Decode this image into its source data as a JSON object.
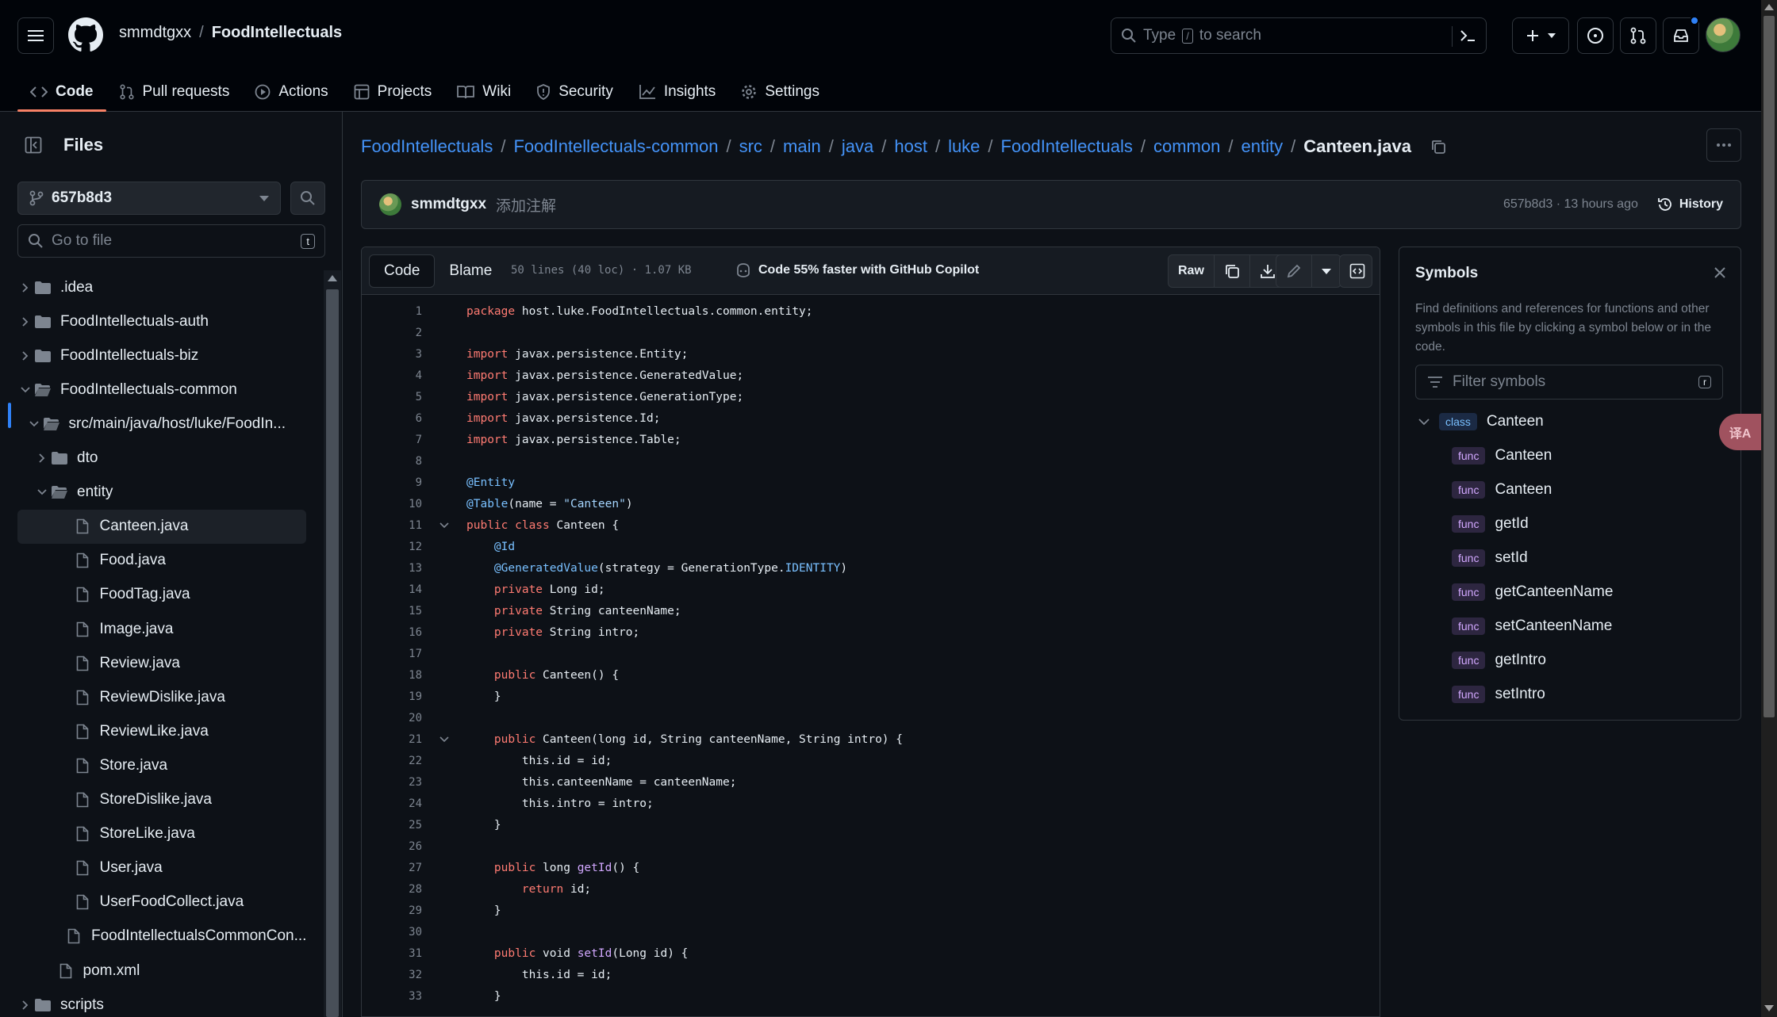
{
  "header": {
    "owner": "smmdtgxx",
    "separator": "/",
    "repo": "FoodIntellectuals",
    "search_prefix": "Type",
    "search_key": "/",
    "search_suffix": "to search"
  },
  "repo_nav": [
    {
      "label": "Code",
      "icon": "code-icon",
      "active": true
    },
    {
      "label": "Pull requests",
      "icon": "pull-request-icon"
    },
    {
      "label": "Actions",
      "icon": "play-icon"
    },
    {
      "label": "Projects",
      "icon": "table-icon"
    },
    {
      "label": "Wiki",
      "icon": "book-icon"
    },
    {
      "label": "Security",
      "icon": "shield-icon"
    },
    {
      "label": "Insights",
      "icon": "graph-icon"
    },
    {
      "label": "Settings",
      "icon": "gear-icon"
    }
  ],
  "sidebar": {
    "title": "Files",
    "branch": "657b8d3",
    "goto_placeholder": "Go to file",
    "goto_key": "t",
    "tree": [
      {
        "label": ".idea",
        "type": "folder",
        "depth": 0,
        "expanded": false
      },
      {
        "label": "FoodIntellectuals-auth",
        "type": "folder",
        "depth": 0,
        "expanded": false
      },
      {
        "label": "FoodIntellectuals-biz",
        "type": "folder",
        "depth": 0,
        "expanded": false
      },
      {
        "label": "FoodIntellectuals-common",
        "type": "folder",
        "depth": 0,
        "expanded": true
      },
      {
        "label": "src/main/java/host/luke/FoodIn...",
        "type": "folder",
        "depth": 1,
        "expanded": true
      },
      {
        "label": "dto",
        "type": "folder",
        "depth": 2,
        "expanded": false
      },
      {
        "label": "entity",
        "type": "folder",
        "depth": 2,
        "expanded": true
      },
      {
        "label": "Canteen.java",
        "type": "file",
        "depth": 3,
        "selected": true
      },
      {
        "label": "Food.java",
        "type": "file",
        "depth": 3
      },
      {
        "label": "FoodTag.java",
        "type": "file",
        "depth": 3
      },
      {
        "label": "Image.java",
        "type": "file",
        "depth": 3
      },
      {
        "label": "Review.java",
        "type": "file",
        "depth": 3
      },
      {
        "label": "ReviewDislike.java",
        "type": "file",
        "depth": 3
      },
      {
        "label": "ReviewLike.java",
        "type": "file",
        "depth": 3
      },
      {
        "label": "Store.java",
        "type": "file",
        "depth": 3
      },
      {
        "label": "StoreDislike.java",
        "type": "file",
        "depth": 3
      },
      {
        "label": "StoreLike.java",
        "type": "file",
        "depth": 3
      },
      {
        "label": "User.java",
        "type": "file",
        "depth": 3
      },
      {
        "label": "UserFoodCollect.java",
        "type": "file",
        "depth": 3
      },
      {
        "label": "FoodIntellectualsCommonCon...",
        "type": "file",
        "depth": 2
      },
      {
        "label": "pom.xml",
        "type": "file",
        "depth": 1
      },
      {
        "label": "scripts",
        "type": "folder",
        "depth": 0,
        "expanded": false
      }
    ]
  },
  "breadcrumb": {
    "parts": [
      "FoodIntellectuals",
      "FoodIntellectuals-common",
      "src",
      "main",
      "java",
      "host",
      "luke",
      "FoodIntellectuals",
      "common",
      "entity"
    ],
    "separator": "/",
    "current": "Canteen.java"
  },
  "commit": {
    "user": "smmdtgxx",
    "message": "添加注解",
    "meta": "657b8d3 · 13 hours ago",
    "history_label": "History"
  },
  "code_toolbar": {
    "code_tab": "Code",
    "blame_tab": "Blame",
    "file_info": "50 lines (40 loc) · 1.07 KB",
    "copilot": "Code 55% faster with GitHub Copilot",
    "raw_label": "Raw"
  },
  "code": [
    {
      "n": "1",
      "t": [
        [
          "kw",
          "package"
        ],
        [
          "p",
          " host.luke.FoodIntellectuals.common.entity;"
        ]
      ]
    },
    {
      "n": "2",
      "t": []
    },
    {
      "n": "3",
      "t": [
        [
          "kw",
          "import"
        ],
        [
          "p",
          " javax.persistence.Entity;"
        ]
      ]
    },
    {
      "n": "4",
      "t": [
        [
          "kw",
          "import"
        ],
        [
          "p",
          " javax.persistence.GeneratedValue;"
        ]
      ]
    },
    {
      "n": "5",
      "t": [
        [
          "kw",
          "import"
        ],
        [
          "p",
          " javax.persistence.GenerationType;"
        ]
      ]
    },
    {
      "n": "6",
      "t": [
        [
          "kw",
          "import"
        ],
        [
          "p",
          " javax.persistence.Id;"
        ]
      ]
    },
    {
      "n": "7",
      "t": [
        [
          "kw",
          "import"
        ],
        [
          "p",
          " javax.persistence.Table;"
        ]
      ]
    },
    {
      "n": "8",
      "t": []
    },
    {
      "n": "9",
      "t": [
        [
          "an",
          "@Entity"
        ]
      ]
    },
    {
      "n": "10",
      "t": [
        [
          "an",
          "@Table"
        ],
        [
          "p",
          "(name = "
        ],
        [
          "st",
          "\"Canteen\""
        ],
        [
          "p",
          ")"
        ]
      ]
    },
    {
      "n": "11",
      "fold": true,
      "t": [
        [
          "kw",
          "public class"
        ],
        [
          "p",
          " Canteen {"
        ]
      ]
    },
    {
      "n": "12",
      "t": [
        [
          "p",
          "    "
        ],
        [
          "an",
          "@Id"
        ]
      ]
    },
    {
      "n": "13",
      "t": [
        [
          "p",
          "    "
        ],
        [
          "an",
          "@GeneratedValue"
        ],
        [
          "p",
          "(strategy = GenerationType."
        ],
        [
          "cn",
          "IDENTITY"
        ],
        [
          "p",
          ")"
        ]
      ]
    },
    {
      "n": "14",
      "t": [
        [
          "p",
          "    "
        ],
        [
          "kw",
          "private"
        ],
        [
          "p",
          " Long id;"
        ]
      ]
    },
    {
      "n": "15",
      "t": [
        [
          "p",
          "    "
        ],
        [
          "kw",
          "private"
        ],
        [
          "p",
          " String canteenName;"
        ]
      ]
    },
    {
      "n": "16",
      "t": [
        [
          "p",
          "    "
        ],
        [
          "kw",
          "private"
        ],
        [
          "p",
          " String intro;"
        ]
      ]
    },
    {
      "n": "17",
      "t": []
    },
    {
      "n": "18",
      "t": [
        [
          "p",
          "    "
        ],
        [
          "kw",
          "public"
        ],
        [
          "p",
          " Canteen() {"
        ]
      ]
    },
    {
      "n": "19",
      "t": [
        [
          "p",
          "    }"
        ]
      ]
    },
    {
      "n": "20",
      "t": []
    },
    {
      "n": "21",
      "fold": true,
      "t": [
        [
          "p",
          "    "
        ],
        [
          "kw",
          "public"
        ],
        [
          "p",
          " Canteen(long id, String canteenName, String intro) {"
        ]
      ]
    },
    {
      "n": "22",
      "t": [
        [
          "p",
          "        this.id = id;"
        ]
      ]
    },
    {
      "n": "23",
      "t": [
        [
          "p",
          "        this.canteenName = canteenName;"
        ]
      ]
    },
    {
      "n": "24",
      "t": [
        [
          "p",
          "        this.intro = intro;"
        ]
      ]
    },
    {
      "n": "25",
      "t": [
        [
          "p",
          "    }"
        ]
      ]
    },
    {
      "n": "26",
      "t": []
    },
    {
      "n": "27",
      "t": [
        [
          "p",
          "    "
        ],
        [
          "kw",
          "public"
        ],
        [
          "p",
          " long "
        ],
        [
          "fn",
          "getId"
        ],
        [
          "p",
          "() {"
        ]
      ]
    },
    {
      "n": "28",
      "t": [
        [
          "p",
          "        "
        ],
        [
          "kw",
          "return"
        ],
        [
          "p",
          " id;"
        ]
      ]
    },
    {
      "n": "29",
      "t": [
        [
          "p",
          "    }"
        ]
      ]
    },
    {
      "n": "30",
      "t": []
    },
    {
      "n": "31",
      "t": [
        [
          "p",
          "    "
        ],
        [
          "kw",
          "public"
        ],
        [
          "p",
          " void "
        ],
        [
          "fn",
          "setId"
        ],
        [
          "p",
          "(Long id) {"
        ]
      ]
    },
    {
      "n": "32",
      "t": [
        [
          "p",
          "        this.id = id;"
        ]
      ]
    },
    {
      "n": "33",
      "t": [
        [
          "p",
          "    }"
        ]
      ]
    }
  ],
  "symbols": {
    "title": "Symbols",
    "description": "Find definitions and references for functions and other symbols in this file by clicking a symbol below or in the code.",
    "filter_placeholder": "Filter symbols",
    "filter_key": "r",
    "class_tag": "class",
    "class_name": "Canteen",
    "func_tag": "func",
    "funcs": [
      "Canteen",
      "Canteen",
      "getId",
      "setId",
      "getCanteenName",
      "setCanteenName",
      "getIntro",
      "setIntro"
    ]
  },
  "translate_fab": "译A",
  "colors": {
    "background": "#0d1117",
    "header_bg": "#010409",
    "border": "#30363d",
    "link": "#4493f8",
    "active_tab": "#f78166",
    "muted": "#7d8590"
  }
}
